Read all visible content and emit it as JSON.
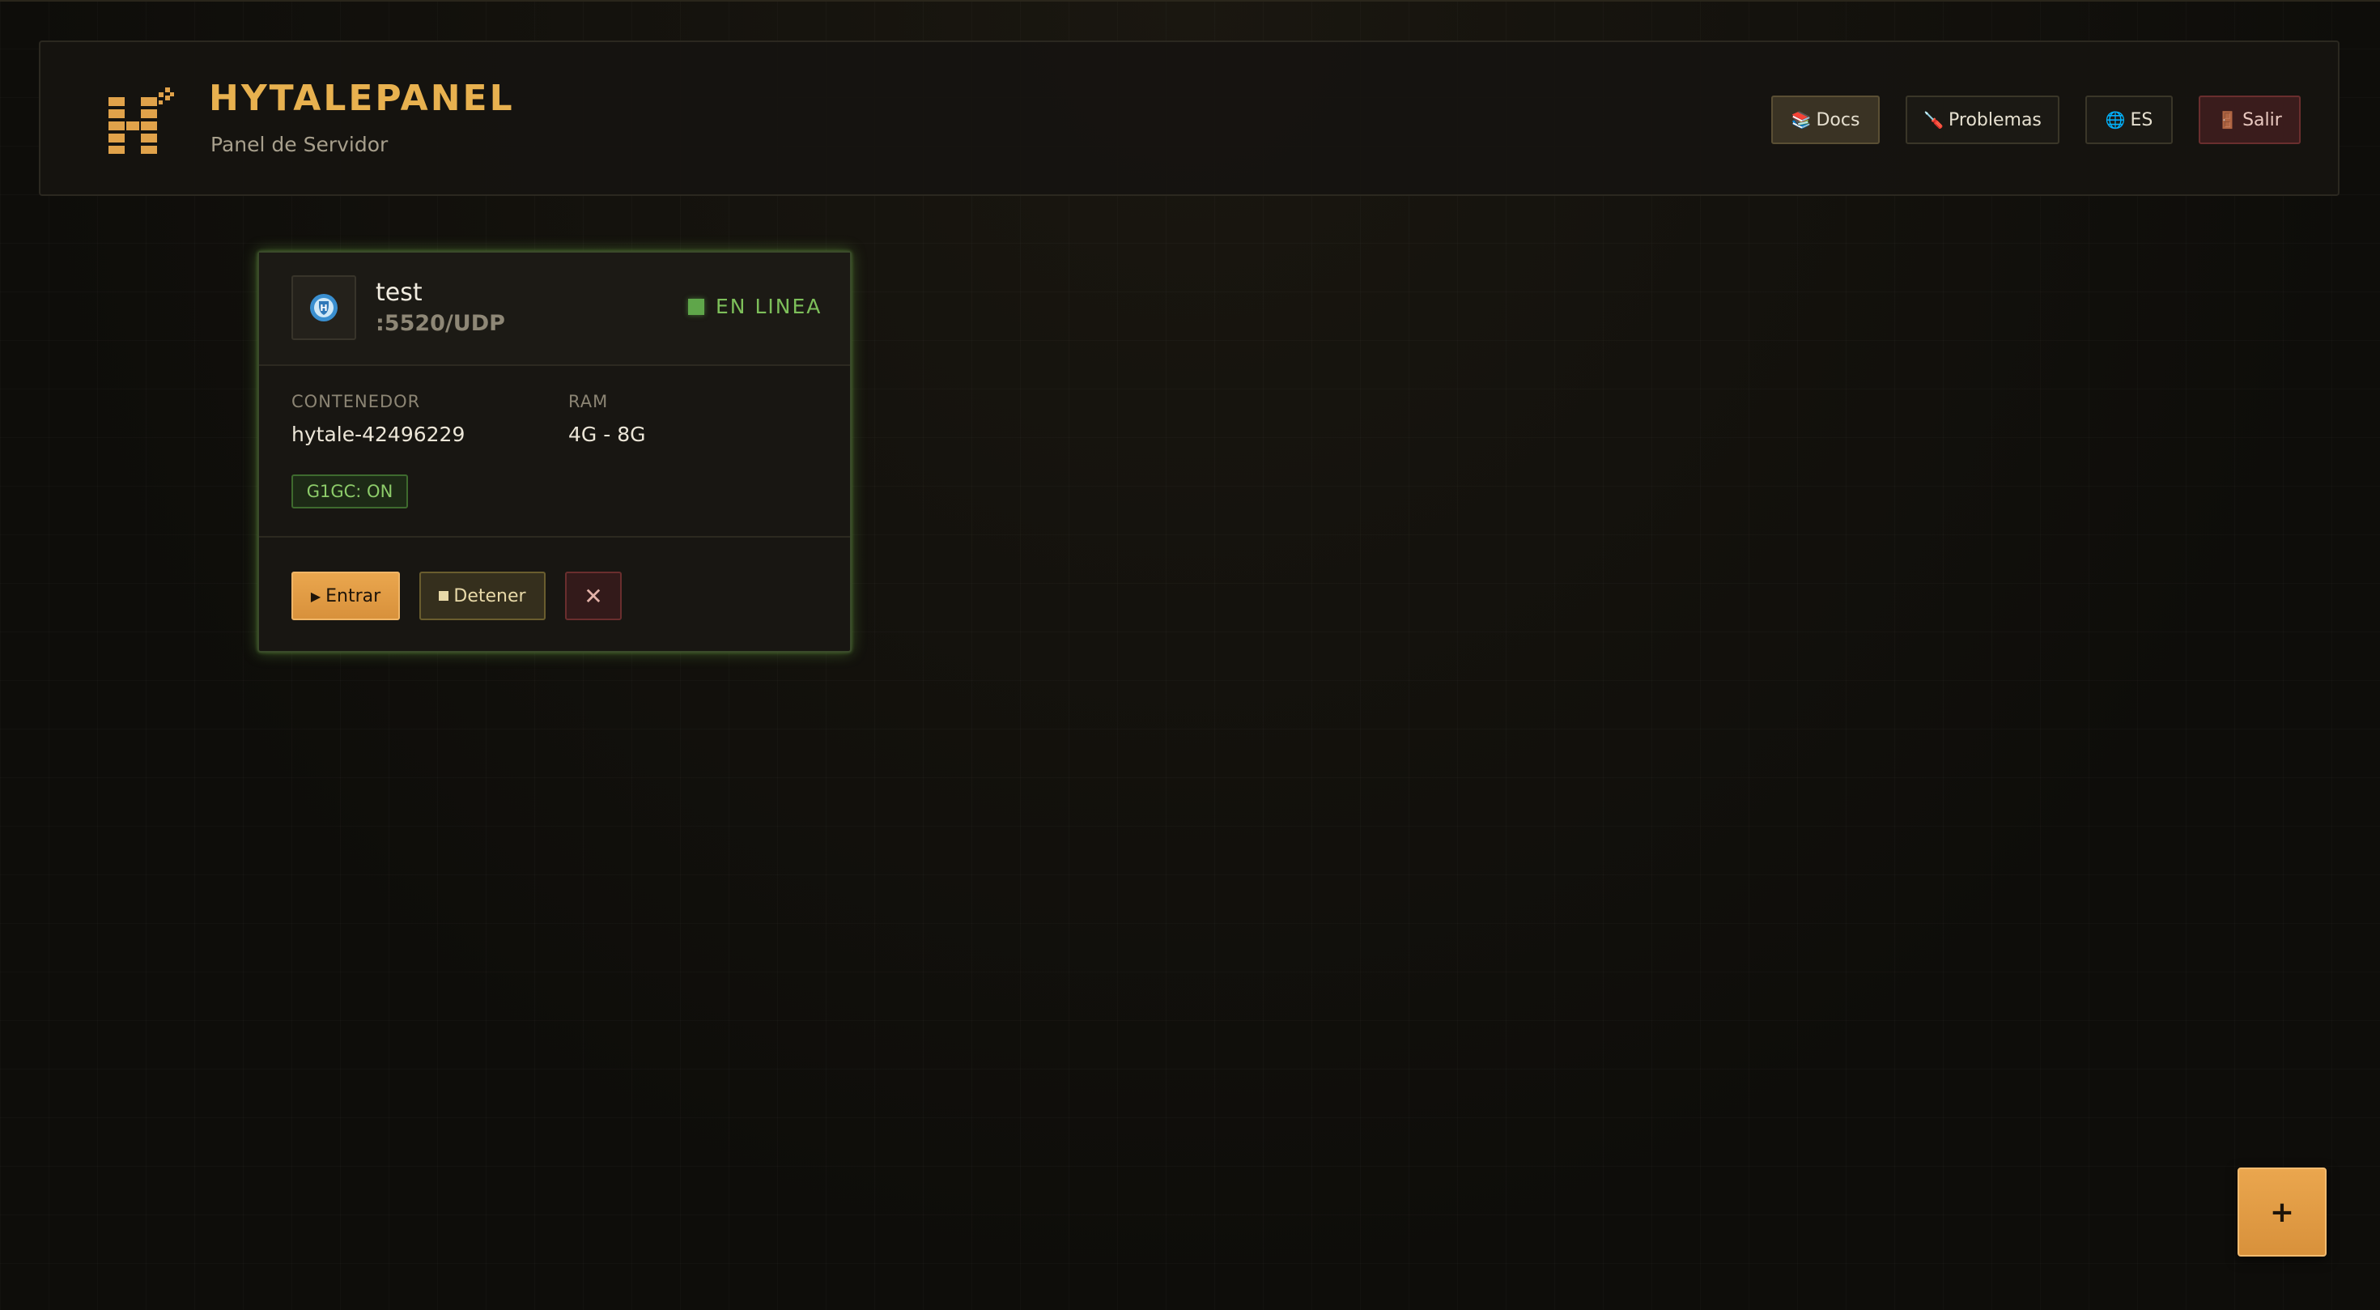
{
  "header": {
    "brand_title": "HYTALEPANEL",
    "brand_subtitle": "Panel de Servidor",
    "logo_icon": "hytale-h-logo-icon",
    "buttons": {
      "docs": {
        "icon": "📚",
        "label": "Docs"
      },
      "problemas": {
        "icon": "🪛",
        "label": "Problemas"
      },
      "lang": {
        "icon": "🌐",
        "label": "ES"
      },
      "salir": {
        "icon": "🚪",
        "label": "Salir"
      }
    }
  },
  "server_card": {
    "name": "test",
    "port": ":5520/UDP",
    "status": "EN LINEA",
    "container_label": "CONTENEDOR",
    "container_value": "hytale-42496229",
    "ram_label": "RAM",
    "ram_value": "4G - 8G",
    "gc_badge": "G1GC: ON",
    "actions": {
      "enter": {
        "icon": "▶",
        "label": "Entrar"
      },
      "stop": {
        "label": "Detener"
      },
      "delete": {
        "icon": "✕"
      }
    }
  },
  "fab": {
    "label": "+"
  },
  "colors": {
    "accent": "#e8b14f",
    "online": "#7dbf5a",
    "danger": "#6a2e2e",
    "background": "#0e0d0a"
  }
}
